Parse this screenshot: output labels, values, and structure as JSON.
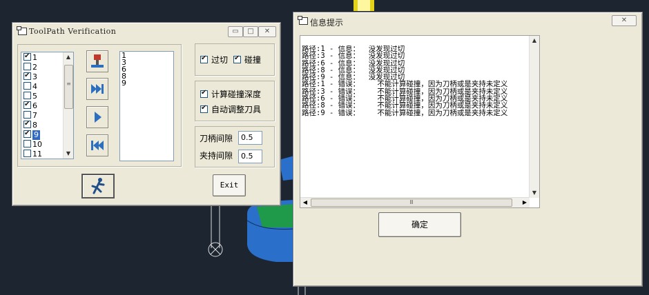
{
  "toolpath_window": {
    "title": "ToolPath Verification",
    "minimize": "▭",
    "restore": "□",
    "close": "✕",
    "path_list": [
      {
        "label": "1",
        "checked": true,
        "selected": false
      },
      {
        "label": "2",
        "checked": false,
        "selected": false
      },
      {
        "label": "3",
        "checked": true,
        "selected": false
      },
      {
        "label": "4",
        "checked": false,
        "selected": false
      },
      {
        "label": "5",
        "checked": false,
        "selected": false
      },
      {
        "label": "6",
        "checked": true,
        "selected": false
      },
      {
        "label": "7",
        "checked": false,
        "selected": false
      },
      {
        "label": "8",
        "checked": true,
        "selected": false
      },
      {
        "label": "9",
        "checked": true,
        "selected": true
      },
      {
        "label": "10",
        "checked": false,
        "selected": false
      },
      {
        "label": "11",
        "checked": false,
        "selected": false
      }
    ],
    "selected_list": [
      "1",
      "3",
      "6",
      "8",
      "9"
    ],
    "overcut_label": "过切",
    "collision_label": "碰撞",
    "calc_depth_label": "计算碰撞深度",
    "auto_adjust_label": "自动调整刀具",
    "holder_gap_label": "刀柄间隙",
    "holder_gap_value": "0.5",
    "clamp_gap_label": "夹持间隙",
    "clamp_gap_value": "0.5",
    "exit_label": "Exit"
  },
  "info_window": {
    "title": "信息提示",
    "close": "✕",
    "messages": [
      "路径:1 - 信息：  没发现过切",
      "路径:3 - 信息：  没发现过切",
      "路径:6 - 信息：  没发现过切",
      "路径:8 - 信息：  没发现过切",
      "路径:9 - 信息：  没发现过切",
      "路径:1 - 错误：    不能计算碰撞，因为刀柄或是夹持未定义",
      "路径:3 - 错误：    不能计算碰撞，因为刀柄或是夹持未定义",
      "路径:6 - 错误：    不能计算碰撞，因为刀柄或是夹持未定义",
      "路径:8 - 错误：    不能计算碰撞，因为刀柄或是夹持未定义",
      "路径:9 - 错误：    不能计算碰撞，因为刀柄或是夹持未定义"
    ],
    "ok_label": "确定",
    "scroll_grip": "Ⅲ"
  }
}
